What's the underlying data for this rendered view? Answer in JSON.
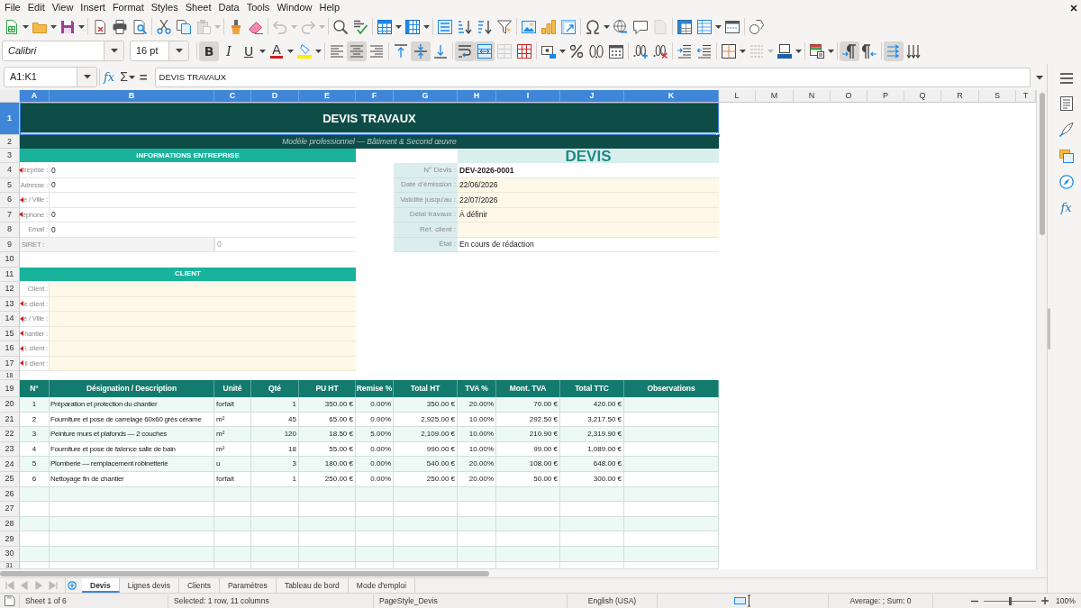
{
  "menu_bar": {
    "items": [
      "File",
      "Edit",
      "View",
      "Insert",
      "Format",
      "Styles",
      "Sheet",
      "Data",
      "Tools",
      "Window",
      "Help"
    ]
  },
  "standard_toolbar": {
    "paste": {
      "disabled": true
    },
    "undo": {
      "disabled": true
    },
    "redo": {
      "disabled": true
    },
    "header_footer": {
      "disabled": true
    }
  },
  "format_toolbar": {
    "font_name": "Calibri",
    "font_size": "16 pt",
    "bold": {
      "label": "B",
      "on": true
    },
    "italic": {
      "label": "I",
      "on": false
    },
    "underline": {
      "label": "U",
      "on": false
    },
    "font_color": {
      "label": "A"
    },
    "align_left": {
      "on": false
    },
    "align_center": {
      "on": true
    },
    "align_right": {
      "on": false
    },
    "align_top": {
      "on": false
    },
    "align_middle": {
      "on": true
    },
    "align_bottom": {
      "on": false
    },
    "wrap_text": {
      "on": true
    },
    "merge_and_center": {
      "on": true
    },
    "merge_cells": {
      "disabled": true
    },
    "border_style": {
      "disabled": true
    },
    "left_to_right": {
      "on": true
    },
    "right_to_left": {
      "on": false
    },
    "text_left_to_right": {
      "on": true
    },
    "text_top_to_bottom": {
      "on": false
    }
  },
  "formula_bar": {
    "name_box": "A1:K1",
    "function_wizard": "fx",
    "sum": "Σ",
    "equals": "=",
    "formula": "DEVIS TRAVAUX"
  },
  "sheet": {
    "columns": [
      {
        "label": "A",
        "selected": true
      },
      {
        "label": "B",
        "selected": true
      },
      {
        "label": "C",
        "selected": true
      },
      {
        "label": "D",
        "selected": true
      },
      {
        "label": "E",
        "selected": true
      },
      {
        "label": "F",
        "selected": true
      },
      {
        "label": "G",
        "selected": true
      },
      {
        "label": "H",
        "selected": true
      },
      {
        "label": "I",
        "selected": true
      },
      {
        "label": "J",
        "selected": true
      },
      {
        "label": "K",
        "selected": true
      },
      {
        "label": "L",
        "selected": false
      },
      {
        "label": "M",
        "selected": false
      },
      {
        "label": "N",
        "selected": false
      },
      {
        "label": "O",
        "selected": false
      },
      {
        "label": "P",
        "selected": false
      },
      {
        "label": "Q",
        "selected": false
      },
      {
        "label": "R",
        "selected": false
      },
      {
        "label": "S",
        "selected": false
      },
      {
        "label": "T",
        "selected": false
      }
    ],
    "rows": [
      {
        "label": "1",
        "selected": true
      },
      {
        "label": "2",
        "selected": false
      },
      {
        "label": "3",
        "selected": false
      },
      {
        "label": "4",
        "selected": false
      },
      {
        "label": "5",
        "selected": false
      },
      {
        "label": "6",
        "selected": false
      },
      {
        "label": "7",
        "selected": false
      },
      {
        "label": "8",
        "selected": false
      },
      {
        "label": "9",
        "selected": false
      },
      {
        "label": "10",
        "selected": false
      },
      {
        "label": "11",
        "selected": false
      },
      {
        "label": "12",
        "selected": false
      },
      {
        "label": "13",
        "selected": false
      },
      {
        "label": "14",
        "selected": false
      },
      {
        "label": "15",
        "selected": false
      },
      {
        "label": "16",
        "selected": false
      },
      {
        "label": "17",
        "selected": false
      },
      {
        "label": "18",
        "selected": false
      },
      {
        "label": "19",
        "selected": false
      },
      {
        "label": "20",
        "selected": false
      },
      {
        "label": "21",
        "selected": false
      },
      {
        "label": "22",
        "selected": false
      },
      {
        "label": "23",
        "selected": false
      },
      {
        "label": "24",
        "selected": false
      },
      {
        "label": "25",
        "selected": false
      },
      {
        "label": "26",
        "selected": false
      },
      {
        "label": "27",
        "selected": false
      },
      {
        "label": "28",
        "selected": false
      },
      {
        "label": "29",
        "selected": false
      },
      {
        "label": "30",
        "selected": false
      },
      {
        "label": "31",
        "selected": false
      }
    ],
    "title": "DEVIS TRAVAUX",
    "subtitle": "Modèle professionnel — Bâtiment & Second œuvre",
    "company": {
      "header": "INFORMATIONS ENTREPRISE",
      "fields": [
        {
          "kind": "field",
          "label": "treprise :",
          "clipped": true,
          "value": "0"
        },
        {
          "kind": "field",
          "label": "Adresse :",
          "clipped": false,
          "value": "0"
        },
        {
          "kind": "field",
          "label": "e / Ville :",
          "clipped": true
        },
        {
          "kind": "field",
          "label": "éphone :",
          "clipped": true,
          "value": "0"
        },
        {
          "kind": "field",
          "label": "Email :",
          "clipped": false,
          "value": "0"
        },
        {
          "kind": "wide",
          "label": "SIRET :",
          "clipped": false,
          "value": "0"
        }
      ]
    },
    "quote": {
      "heading": "DEVIS",
      "fields": [
        {
          "label": "N° Devis :",
          "value": "DEV-2026-0001",
          "input": false,
          "bold": true
        },
        {
          "label": "Date d'émission :",
          "value": "22/06/2026",
          "input": true,
          "bold": false
        },
        {
          "label": "Validité jusqu'au :",
          "value": "22/07/2026",
          "input": true,
          "bold": false
        },
        {
          "label": "Délai travaux :",
          "value": "À définir",
          "input": true,
          "bold": false
        },
        {
          "label": "Réf. client :",
          "input": true,
          "bold": false
        },
        {
          "label": "État :",
          "value": "En cours de rédaction",
          "input": false,
          "bold": false
        }
      ]
    },
    "client": {
      "header": "CLIENT",
      "fields": [
        {
          "label": "Client :",
          "clipped": false
        },
        {
          "label": "e client :",
          "clipped": true
        },
        {
          "label": "e / Ville :",
          "clipped": true
        },
        {
          "label": "hantier :",
          "clipped": true
        },
        {
          "label": "l. client :",
          "clipped": true
        },
        {
          "label": "il client :",
          "clipped": true
        }
      ]
    },
    "items": {
      "columns": [
        "N°",
        "Désignation / Description",
        "Unité",
        "Qté",
        "PU HT",
        "Remise %",
        "Total HT",
        "TVA %",
        "Mont. TVA",
        "Total TTC",
        "Observations"
      ],
      "rows": [
        [
          "1",
          "Préparation et protection du chantier",
          "forfait",
          "1",
          "350.00 €",
          "0.00%",
          "350.00 €",
          "20.00%",
          "70.00 €",
          "420.00 €"
        ],
        [
          "2",
          "Fourniture et pose de carrelage 60x60 grès cérame",
          "m²",
          "45",
          "65.00 €",
          "0.00%",
          "2,925.00 €",
          "10.00%",
          "292.50 €",
          "3,217.50 €"
        ],
        [
          "3",
          "Peinture murs et plafonds — 2 couches",
          "m²",
          "120",
          "18.50 €",
          "5.00%",
          "2,109.00 €",
          "10.00%",
          "210.90 €",
          "2,319.90 €"
        ],
        [
          "4",
          "Fourniture et pose de faïence salle de bain",
          "m²",
          "18",
          "55.00 €",
          "0.00%",
          "990.00 €",
          "10.00%",
          "99.00 €",
          "1,089.00 €"
        ],
        [
          "5",
          "Plomberie — remplacement robinetterie",
          "u",
          "3",
          "180.00 €",
          "0.00%",
          "540.00 €",
          "20.00%",
          "108.00 €",
          "648.00 €"
        ],
        [
          "6",
          "Nettoyage fin de chantier",
          "forfait",
          "1",
          "250.00 €",
          "0.00%",
          "250.00 €",
          "20.00%",
          "50.00 €",
          "300.00 €"
        ]
      ]
    }
  },
  "sheet_tab_nav": {
    "disabled": true
  },
  "sheet_tabs": [
    {
      "label": "Devis",
      "selected": true
    },
    {
      "label": "Lignes devis",
      "selected": false
    },
    {
      "label": "Clients",
      "selected": false
    },
    {
      "label": "Paramètres",
      "selected": false
    },
    {
      "label": "Tableau de bord",
      "selected": false
    },
    {
      "label": "Mode d'emploi",
      "selected": false
    }
  ],
  "status_bar": {
    "sheet": "Sheet 1 of 6",
    "selection": "Selected: 1 row, 11 columns",
    "page_style": "PageStyle_Devis",
    "language": "English (USA)",
    "summary": "Average: ; Sum: 0",
    "zoom": {
      "level": 0.5,
      "reading": "100%"
    }
  },
  "sidebar": {
    "functions": "fx"
  }
}
